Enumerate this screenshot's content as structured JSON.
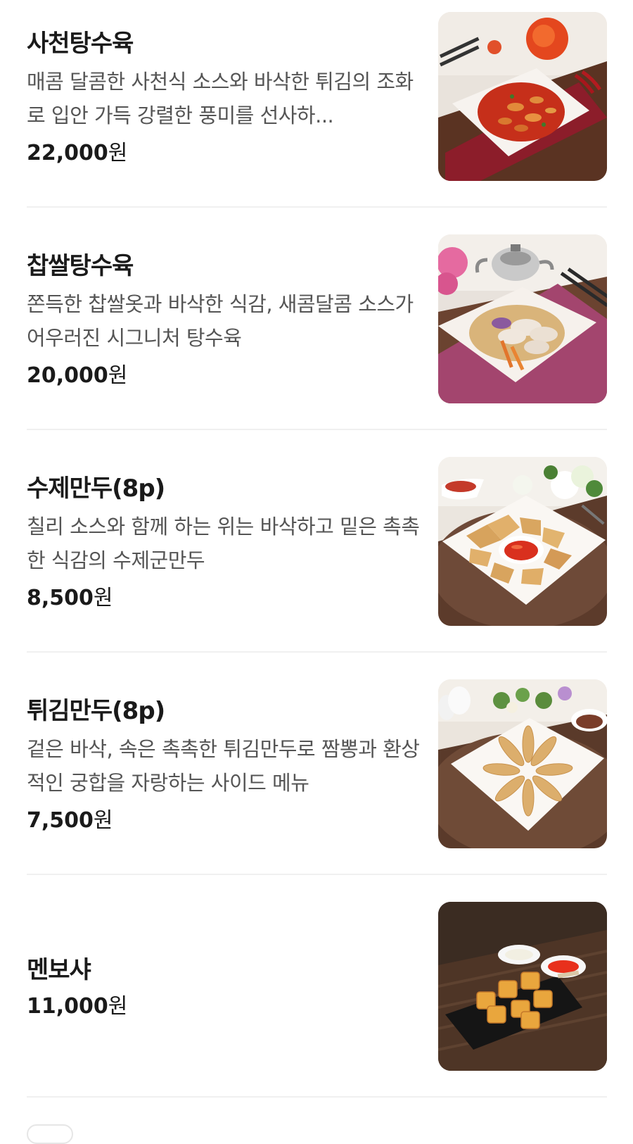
{
  "menu": {
    "items": [
      {
        "name": "사천탕수육",
        "description": "매콤 달콤한 사천식 소스와 바삭한 튀김의 조화로 입안 가득 강렬한 풍미를 선사하...",
        "price": "22,000",
        "currency": "원",
        "image": "sichuan-sweet-sour-pork-photo"
      },
      {
        "name": "찹쌀탕수육",
        "description": "쫀득한 찹쌀옷과 바삭한 식감, 새콤달콤 소스가 어우러진 시그니처 탕수육",
        "price": "20,000",
        "currency": "원",
        "image": "glutinous-rice-sweet-sour-pork-photo"
      },
      {
        "name": "수제만두(8p)",
        "description": "칠리 소스와 함께 하는 위는 바삭하고 밑은 촉촉한 식감의 수제군만두",
        "price": "8,500",
        "currency": "원",
        "image": "handmade-dumplings-photo"
      },
      {
        "name": "튀김만두(8p)",
        "description": "겉은 바삭, 속은 촉촉한 튀김만두로 짬뽕과 환상적인 궁합을 자랑하는 사이드 메뉴",
        "price": "7,500",
        "currency": "원",
        "image": "fried-dumplings-photo"
      },
      {
        "name": "멘보샤",
        "price": "11,000",
        "currency": "원",
        "image": "menbosha-shrimp-toast-photo"
      }
    ]
  }
}
